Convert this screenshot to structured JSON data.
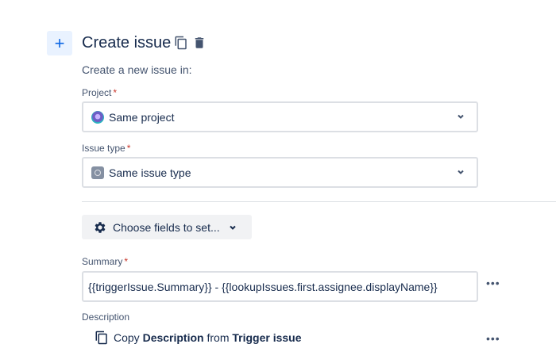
{
  "header": {
    "title": "Create issue",
    "subtitle": "Create a new issue in:"
  },
  "project": {
    "label": "Project",
    "required": "*",
    "value": "Same project"
  },
  "issue_type": {
    "label": "Issue type",
    "required": "*",
    "value": "Same issue type"
  },
  "choose_fields": {
    "label": "Choose fields to set..."
  },
  "summary": {
    "label": "Summary",
    "required": "*",
    "value": "{{triggerIssue.Summary}} - {{lookupIssues.first.assignee.displayName}}"
  },
  "description": {
    "label": "Description",
    "copy": "Copy",
    "field": "Description",
    "from": "from",
    "source": "Trigger issue"
  },
  "more_label": "•••"
}
